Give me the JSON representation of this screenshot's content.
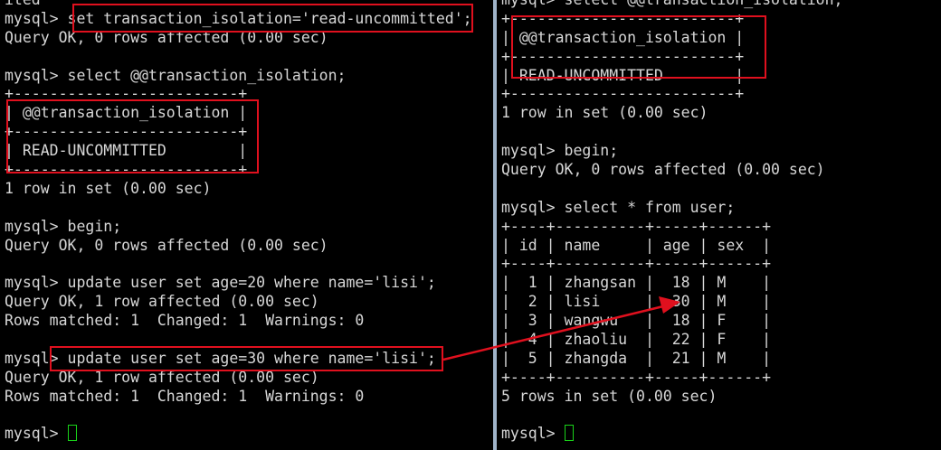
{
  "colors": {
    "background": "#000000",
    "text": "#d7d7d7",
    "highlight": "#e0101e",
    "cursor": "#19d219",
    "divider": "#9fb3c8"
  },
  "left_terminal": {
    "lines": [
      "ited",
      "mysql> set transaction_isolation='read-uncommitted';",
      "Query OK, 0 rows affected (0.00 sec)",
      "",
      "mysql> select @@transaction_isolation;",
      "+-------------------------+",
      "| @@transaction_isolation |",
      "+-------------------------+",
      "| READ-UNCOMMITTED        |",
      "+-------------------------+",
      "1 row in set (0.00 sec)",
      "",
      "mysql> begin;",
      "Query OK, 0 rows affected (0.00 sec)",
      "",
      "mysql> update user set age=20 where name='lisi';",
      "Query OK, 1 row affected (0.00 sec)",
      "Rows matched: 1  Changed: 1  Warnings: 0",
      "",
      "mysql> update user set age=30 where name='lisi';",
      "Query OK, 1 row affected (0.00 sec)",
      "Rows matched: 1  Changed: 1  Warnings: 0",
      "",
      "mysql> "
    ]
  },
  "right_terminal": {
    "lines": [
      "mysql> select @@transaction_isolation;",
      "+-------------------------+",
      "| @@transaction_isolation |",
      "+-------------------------+",
      "| READ-UNCOMMITTED        |",
      "+-------------------------+",
      "1 row in set (0.00 sec)",
      "",
      "mysql> begin;",
      "Query OK, 0 rows affected (0.00 sec)",
      "",
      "mysql> select * from user;",
      "+----+----------+-----+------+",
      "| id | name     | age | sex  |",
      "+----+----------+-----+------+",
      "|  1 | zhangsan |  18 | M    |",
      "|  2 | lisi     |  30 | M    |",
      "|  3 | wangwu   |  18 | F    |",
      "|  4 | zhaoliu  |  22 | F    |",
      "|  5 | zhangda  |  21 | M    |",
      "+----+----------+-----+------+",
      "5 rows in set (0.00 sec)",
      "",
      "mysql> "
    ]
  }
}
